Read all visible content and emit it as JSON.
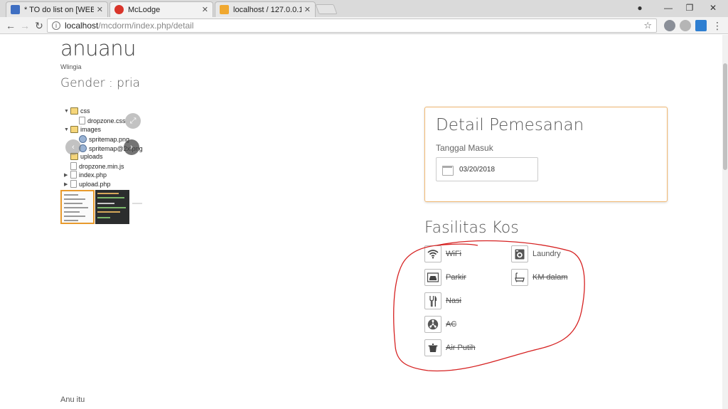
{
  "browser": {
    "tabs": [
      {
        "title": "* TO do list on [WEB] Ko",
        "active": false,
        "favicon_color": "#3f6fc2"
      },
      {
        "title": "McLodge",
        "active": true,
        "favicon_color": "#d9352b"
      },
      {
        "title": "localhost / 127.0.0.1 / m",
        "active": false,
        "favicon_color": "#f0a830"
      }
    ],
    "url_host": "localhost",
    "url_path": "/mcdorm/index.php/detail",
    "window_controls": {
      "minimize": "—",
      "maximize": "❐",
      "close": "✕",
      "profile": "●"
    }
  },
  "kos": {
    "name": "anuanu",
    "location": "Wlingia",
    "gender": "Gender : pria"
  },
  "gallery": {
    "tree": [
      {
        "label": "css",
        "type": "folder",
        "expanded": true,
        "indent": 0
      },
      {
        "label": "dropzone.css",
        "type": "file",
        "indent": 1
      },
      {
        "label": "images",
        "type": "folder",
        "expanded": true,
        "indent": 0
      },
      {
        "label": "spritemap.png",
        "type": "img",
        "indent": 1
      },
      {
        "label": "spritemap@2x.png",
        "type": "img",
        "indent": 1
      },
      {
        "label": "uploads",
        "type": "folder",
        "expanded": false,
        "indent": 0
      },
      {
        "label": "dropzone.min.js",
        "type": "file",
        "indent": 0
      },
      {
        "label": "index.php",
        "type": "file",
        "collapsed": true,
        "indent": 0
      },
      {
        "label": "upload.php",
        "type": "file",
        "collapsed": true,
        "indent": 0
      }
    ]
  },
  "detail": {
    "title": "Detail Pemesanan",
    "date_label": "Tanggal Masuk",
    "date_value": "03/20/2018",
    "accent_color": "#f0b872"
  },
  "fasilitas": {
    "title": "Fasilitas Kos",
    "items": [
      {
        "label": "WiFi",
        "available": false,
        "icon": "wifi-icon"
      },
      {
        "label": "Laundry",
        "available": true,
        "icon": "washing-machine-icon"
      },
      {
        "label": "Parkir",
        "available": false,
        "icon": "car-icon"
      },
      {
        "label": "KM dalam",
        "available": false,
        "icon": "bathtub-icon"
      },
      {
        "label": "Nasi",
        "available": false,
        "icon": "utensils-icon"
      },
      {
        "label": "AC",
        "available": false,
        "icon": "fan-icon"
      },
      {
        "label": "Air Putih",
        "available": false,
        "icon": "water-pot-icon"
      }
    ],
    "annotation_color": "#d62222"
  },
  "footer": {
    "text": "Anu itu"
  }
}
